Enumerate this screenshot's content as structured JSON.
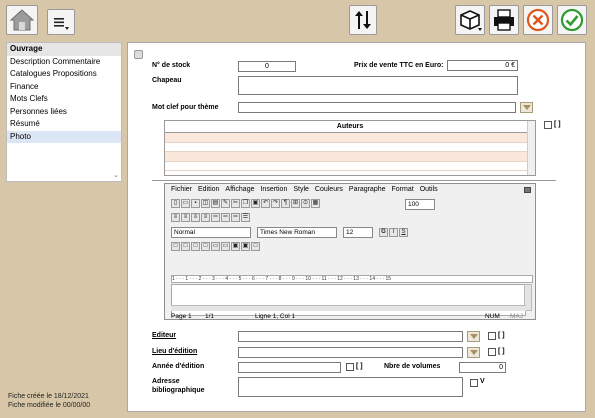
{
  "toolbar": {
    "home": "home-icon",
    "menu": "menu-icon",
    "sort": "sort-icon",
    "package": "package-icon",
    "print": "printer-icon",
    "cancel": "cancel-icon",
    "ok": "ok-icon"
  },
  "sidebar": {
    "items": [
      {
        "label": "Ouvrage"
      },
      {
        "label": "Description Commentaire"
      },
      {
        "label": "Catalogues Propositions"
      },
      {
        "label": "Finance"
      },
      {
        "label": "Mots Clefs"
      },
      {
        "label": "Personnes liées"
      },
      {
        "label": "Résumé"
      },
      {
        "label": "Photo"
      }
    ]
  },
  "footer": {
    "created": "Fiche créée le 18/12/2021",
    "modified": "Fiche modifiée le 00/00/00"
  },
  "form": {
    "stock_label": "N° de stock",
    "stock_value": "0",
    "price_label": "Prix de vente TTC en Euro:",
    "price_value": "0 €",
    "chapeau_label": "Chapeau",
    "keyword_label": "Mot clef pour thème",
    "authors_header": "Auteurs",
    "authors_check": "[ ]",
    "editeur_label": "Editeur",
    "editeur_check": "[ ]",
    "lieu_label": "Lieu d'édition",
    "lieu_check": "[ ]",
    "annee_label": "Année d'édition",
    "annee_check": "[ ]",
    "volumes_label": "Nbre de volumes",
    "volumes_value": "0",
    "adresse_label": "Adresse bibliographique",
    "adresse_check": "V"
  },
  "editor": {
    "menu": [
      "Fichier",
      "Edition",
      "Affichage",
      "Insertion",
      "Style",
      "Couleurs",
      "Paragraphe",
      "Format",
      "Outils"
    ],
    "zoom": "100",
    "style": "Normal",
    "font": "Times New Roman",
    "size": "12",
    "bold": "G",
    "italic": "I",
    "underline": "S",
    "ruler": "1 · · · 1 · · · 2 · · · 3 · · · 4 · · · 5 · · · 6 · · · 7 · · · 8 · · · 9 · · · 10 · · · 11 · · · 12 · · · 13 · · · 14 · · · 15",
    "status": {
      "page": "Page 1",
      "pages": "1/1",
      "line": "Ligne 1, Col 1",
      "num": "NUM",
      "maj": "MAJ"
    }
  }
}
